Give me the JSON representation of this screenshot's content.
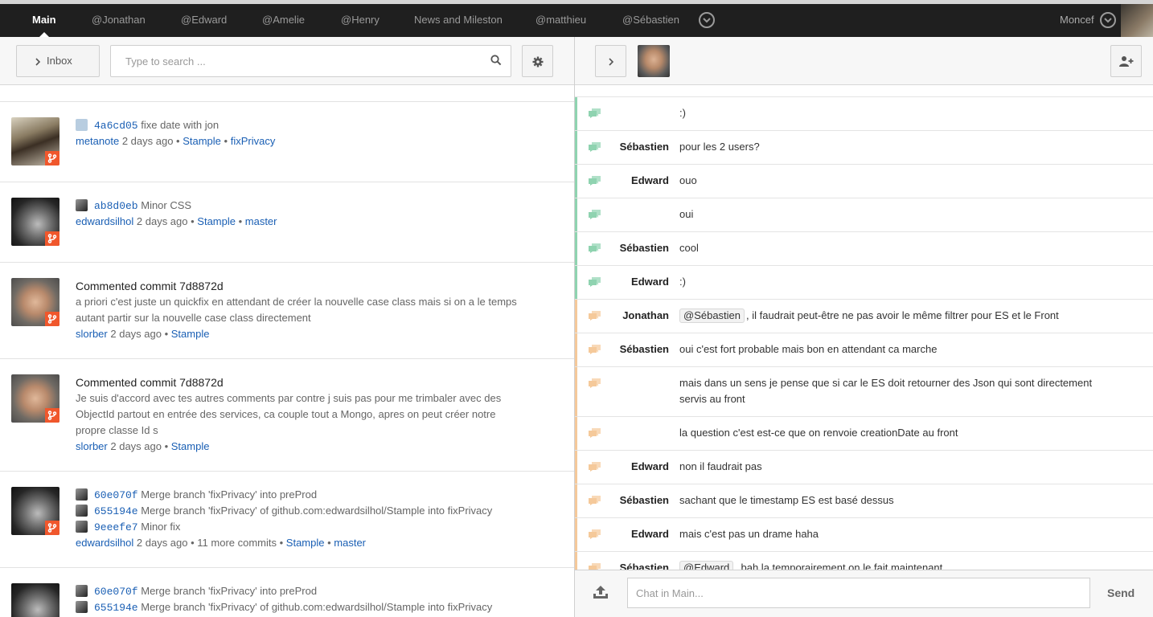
{
  "topbar": {
    "tabs": [
      {
        "label": "Main",
        "active": true
      },
      {
        "label": "@Jonathan"
      },
      {
        "label": "@Edward"
      },
      {
        "label": "@Amelie"
      },
      {
        "label": "@Henry"
      },
      {
        "label": "News and Milestones"
      },
      {
        "label": "@matthieu"
      },
      {
        "label": "@Sébastien"
      }
    ],
    "user": "Moncef"
  },
  "left": {
    "inbox_label": "Inbox",
    "search_placeholder": "Type to search ...",
    "feed": [
      {
        "commits": [
          {
            "sha": "4a6cd05",
            "msg": "fixe date with jon"
          }
        ],
        "author": "metanote",
        "time": "2 days ago",
        "repo": "Stample",
        "branch": "fixPrivacy"
      },
      {
        "commits": [
          {
            "sha": "ab8d0eb",
            "msg": "Minor CSS"
          }
        ],
        "author": "edwardsilhol",
        "time": "2 days ago",
        "repo": "Stample",
        "branch": "master"
      },
      {
        "title": "Commented commit 7d8872d",
        "body": "a priori c'est juste un quickfix en attendant de créer la nouvelle case class mais si on a le temps autant partir sur la nouvelle case class directement",
        "author": "slorber",
        "time": "2 days ago",
        "repo": "Stample"
      },
      {
        "title": "Commented commit 7d8872d",
        "body": "Je suis d'accord avec tes autres comments par contre j suis pas pour me trimbaler avec des ObjectId partout en entrée des services, ca couple tout a Mongo, apres on peut créer notre propre classe Id s",
        "author": "slorber",
        "time": "2 days ago",
        "repo": "Stample"
      },
      {
        "commits": [
          {
            "sha": "60e070f",
            "msg": "Merge branch 'fixPrivacy' into preProd"
          },
          {
            "sha": "655194e",
            "msg": "Merge branch 'fixPrivacy' of github.com:edwardsilhol/Stample into fixPrivacy"
          },
          {
            "sha": "9eeefe7",
            "msg": "Minor fix"
          }
        ],
        "author": "edwardsilhol",
        "time": "2 days ago",
        "more": "11 more commits",
        "repo": "Stample",
        "branch": "master"
      },
      {
        "commits": [
          {
            "sha": "60e070f",
            "msg": "Merge branch 'fixPrivacy' into preProd"
          },
          {
            "sha": "655194e",
            "msg": "Merge branch 'fixPrivacy' of github.com:edwardsilhol/Stample into fixPrivacy"
          }
        ]
      }
    ]
  },
  "chat": {
    "messages": [
      {
        "who": "",
        "text": ":)",
        "color": "#8fd3b0"
      },
      {
        "who": "Sébastien",
        "text": "pour les 2 users?",
        "color": "#8fd3b0"
      },
      {
        "who": "Edward",
        "text": "ouo",
        "color": "#8fd3b0"
      },
      {
        "who": "",
        "text": "oui",
        "color": "#8fd3b0"
      },
      {
        "who": "Sébastien",
        "text": "cool",
        "color": "#8fd3b0"
      },
      {
        "who": "Edward",
        "text": ":)",
        "color": "#8fd3b0"
      },
      {
        "who": "Jonathan",
        "mention": "@Sébastien",
        "text": ", il faudrait peut-être ne pas avoir le même filtrer pour ES et le Front",
        "color": "#f5c99a"
      },
      {
        "who": "Sébastien",
        "text": "oui c'est fort probable mais bon en attendant ca marche",
        "color": "#f5c99a"
      },
      {
        "who": "",
        "text": "mais dans un sens je pense que si car le ES doit retourner des Json qui sont directement servis au front",
        "color": "#f5c99a"
      },
      {
        "who": "",
        "text": "la question c'est est-ce que on renvoie creationDate au front",
        "color": "#f5c99a"
      },
      {
        "who": "Edward",
        "text": "non il faudrait pas",
        "color": "#f5c99a"
      },
      {
        "who": "Sébastien",
        "text": "sachant que le timestamp ES est basé dessus",
        "color": "#f5c99a"
      },
      {
        "who": "Edward",
        "text": "mais c'est pas un drame haha",
        "color": "#f5c99a"
      },
      {
        "who": "Sébastien",
        "mention": "@Edward",
        "text": ", bah la temporairement on le fait maintenant",
        "color": "#f5c99a"
      }
    ],
    "input_placeholder": "Chat in Main...",
    "send_label": "Send"
  }
}
